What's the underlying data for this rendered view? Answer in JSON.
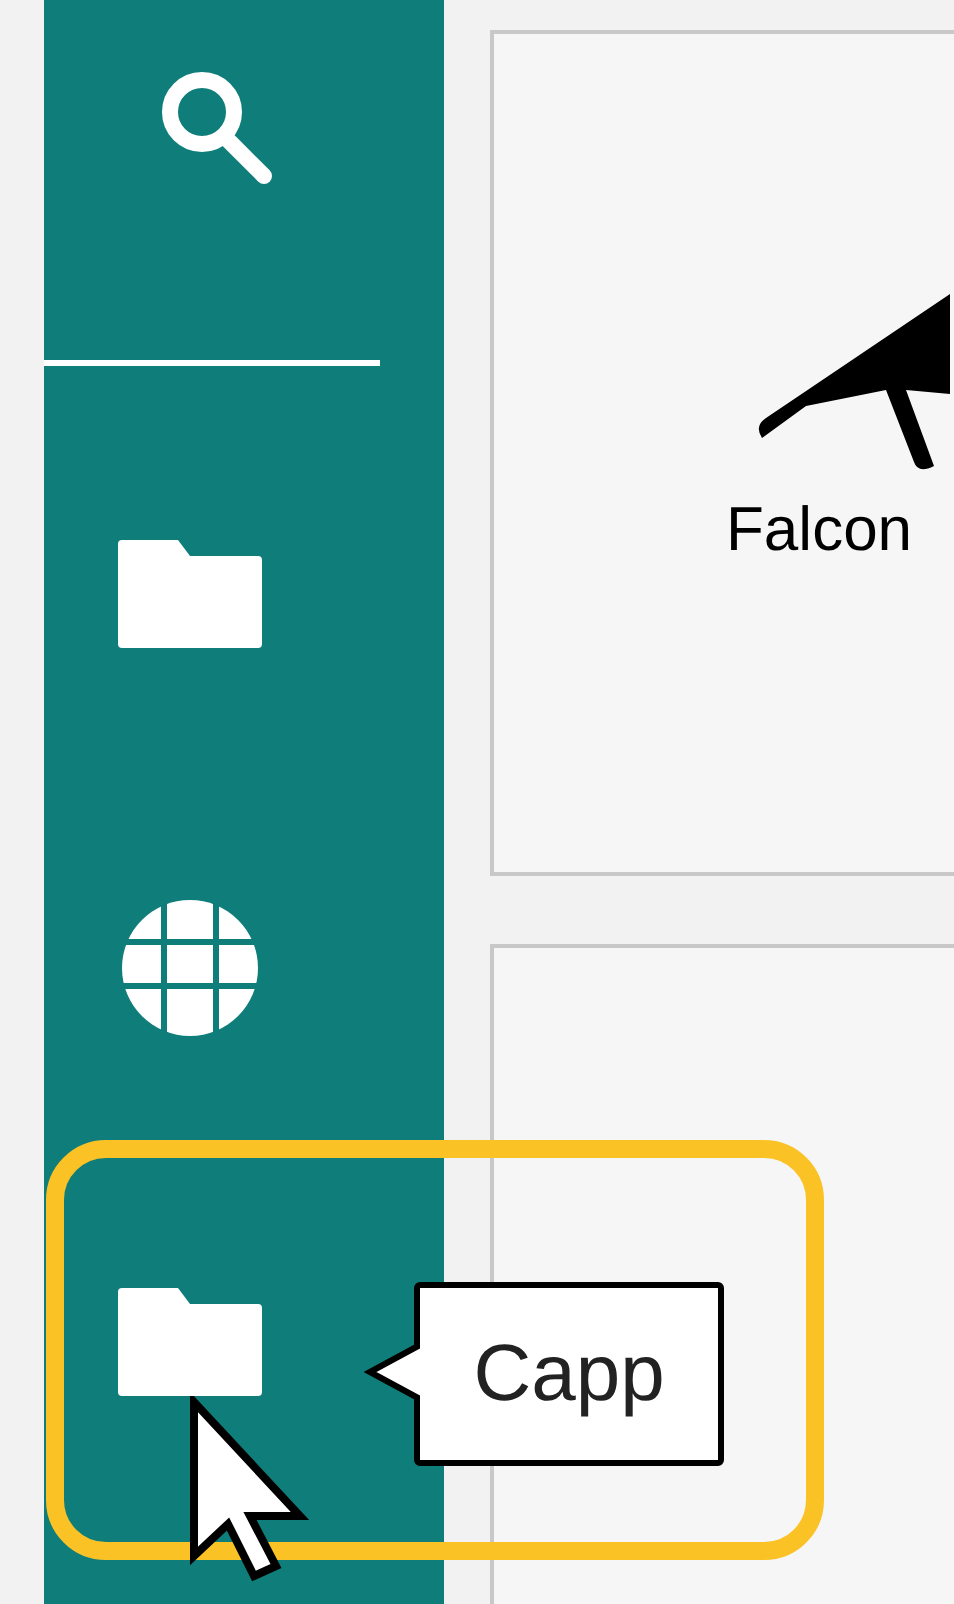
{
  "sidebar": {
    "items": [
      {
        "kind": "search"
      },
      {
        "kind": "divider"
      },
      {
        "kind": "folder"
      },
      {
        "kind": "globe"
      },
      {
        "kind": "folder"
      }
    ]
  },
  "tooltip": {
    "text": "Capp"
  },
  "cards": [
    {
      "label": "Falcon"
    }
  ]
}
